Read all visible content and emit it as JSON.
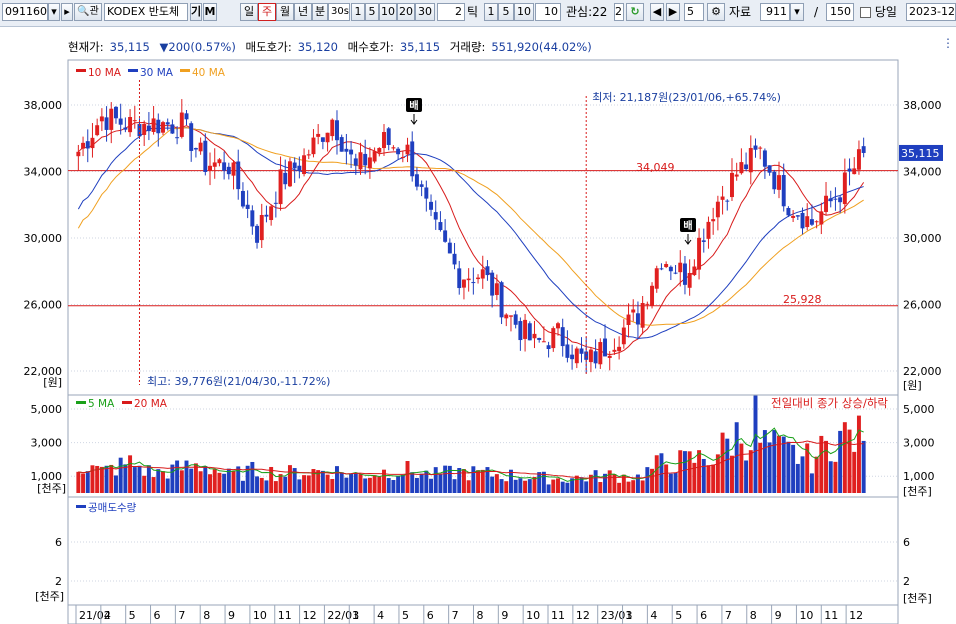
{
  "toolbar": {
    "code": "091160",
    "name": "KODEX 반도체",
    "name_btns": [
      "기",
      "M"
    ],
    "periods": [
      "일",
      "주",
      "월",
      "년",
      "분"
    ],
    "selected_period": "주",
    "minute_box": "30s",
    "intervals_a": [
      "1",
      "5",
      "10",
      "20",
      "30"
    ],
    "tick_value": "2",
    "tick_label": "틱",
    "intervals_b": [
      "1",
      "5",
      "10"
    ],
    "tick_count": "10",
    "watch_label": "관심:22",
    "watch_num": "2",
    "step_value": "5",
    "data_label": "자료",
    "data_count": "911",
    "divider": "/",
    "total": "150",
    "current_label": "당일",
    "date": "2023-12-"
  },
  "quote": {
    "price_label": "현재가:",
    "price": "35,115",
    "change": "200(0.57%)",
    "ask_label": "매도호가:",
    "ask": "35,120",
    "bid_label": "매수호가:",
    "bid": "35,115",
    "volume_label": "거래량:",
    "volume": "551,920(44.02%)"
  },
  "legend_price": [
    {
      "name": "10 MA",
      "color": "#d81b1b"
    },
    {
      "name": "30 MA",
      "color": "#1f3fbf"
    },
    {
      "name": "40 MA",
      "color": "#f0a020"
    }
  ],
  "legend_volume": [
    {
      "name": "5 MA",
      "color": "#1aa01a"
    },
    {
      "name": "20 MA",
      "color": "#d81b1b"
    }
  ],
  "volume_right_label": "전일대비 종가 상승/하락",
  "legend_short": {
    "name": "공매도수량",
    "color": "#1f3fbf"
  },
  "annotations": {
    "low": "최저: 21,187원(23/01/06,+65.74%)",
    "high": "최고: 39,776원(21/04/30,-11.72%)",
    "line_high": "34,049",
    "line_low": "25,928",
    "bae": "배",
    "current_price": "35,115"
  },
  "axis_price": [
    "38,000",
    "34,000",
    "30,000",
    "26,000",
    "22,000"
  ],
  "axis_price_unit": "[원]",
  "axis_volume": [
    "5,000",
    "3,000",
    "1,000"
  ],
  "axis_volume_unit": "[천주]",
  "axis_short": [
    "6",
    "2"
  ],
  "axis_short_unit": "[천주]",
  "x_labels": [
    "21/02",
    "4",
    "5",
    "6",
    "7",
    "8",
    "9",
    "10",
    "11",
    "12",
    "22/01",
    "3",
    "4",
    "5",
    "6",
    "7",
    "8",
    "9",
    "10",
    "11",
    "12",
    "23/01",
    "3",
    "4",
    "5",
    "6",
    "7",
    "8",
    "9",
    "10",
    "11",
    "12"
  ],
  "colors": {
    "up": "#e02020",
    "down": "#1f3fbf",
    "grid": "#cfd6e2",
    "hline": "#d81b1b"
  },
  "chart_data": {
    "type": "candlestick",
    "period": "weekly",
    "x": [
      "21/02",
      "21/04",
      "21/05",
      "21/06",
      "21/07",
      "21/08",
      "21/09",
      "21/10",
      "21/11",
      "21/12",
      "22/01",
      "22/03",
      "22/04",
      "22/05",
      "22/06",
      "22/07",
      "22/08",
      "22/09",
      "22/10",
      "22/11",
      "22/12",
      "23/01",
      "23/03",
      "23/04",
      "23/05",
      "23/06",
      "23/07",
      "23/08",
      "23/09",
      "23/10",
      "23/11",
      "23/12"
    ],
    "close": [
      35200,
      37300,
      36800,
      36900,
      36800,
      34500,
      34400,
      30300,
      33400,
      34800,
      37200,
      34100,
      35800,
      35200,
      30900,
      27800,
      27800,
      25200,
      23600,
      24200,
      22400,
      23700,
      25400,
      28900,
      27800,
      31800,
      33900,
      35200,
      32100,
      30900,
      32800,
      35115
    ],
    "volume": [
      1700,
      1200,
      1700,
      1100,
      1400,
      1600,
      1000,
      1300,
      1100,
      1200,
      1300,
      1000,
      1200,
      1300,
      1000,
      1200,
      1100,
      1000,
      900,
      800,
      900,
      1000,
      900,
      1700,
      1800,
      2100,
      3300,
      2900,
      2300,
      1900,
      3300,
      3100
    ],
    "hlines": [
      34049,
      25928
    ],
    "ylim_price": [
      21000,
      40500
    ],
    "ylim_volume": [
      0,
      6000
    ]
  }
}
